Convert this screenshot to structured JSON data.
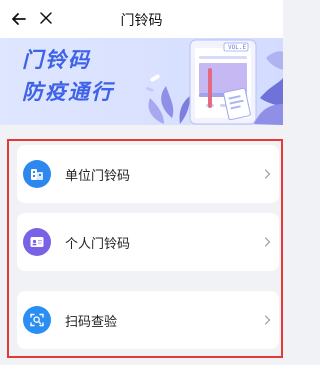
{
  "header": {
    "title": "门铃码",
    "back_icon": "arrow-left-icon",
    "close_icon": "close-icon"
  },
  "banner": {
    "line1": "门铃码",
    "line2": "防疫通行",
    "tag": "VOL.E",
    "accent_color": "#3f63e8"
  },
  "menu": {
    "items": [
      {
        "label": "单位门铃码",
        "icon": "building-icon",
        "color": "#2c88ee"
      },
      {
        "label": "个人门铃码",
        "icon": "id-card-icon",
        "color": "#7a62e6"
      },
      {
        "label": "扫码查验",
        "icon": "scan-icon",
        "color": "#2a8ef2"
      }
    ]
  },
  "highlight_color": "#e53935"
}
